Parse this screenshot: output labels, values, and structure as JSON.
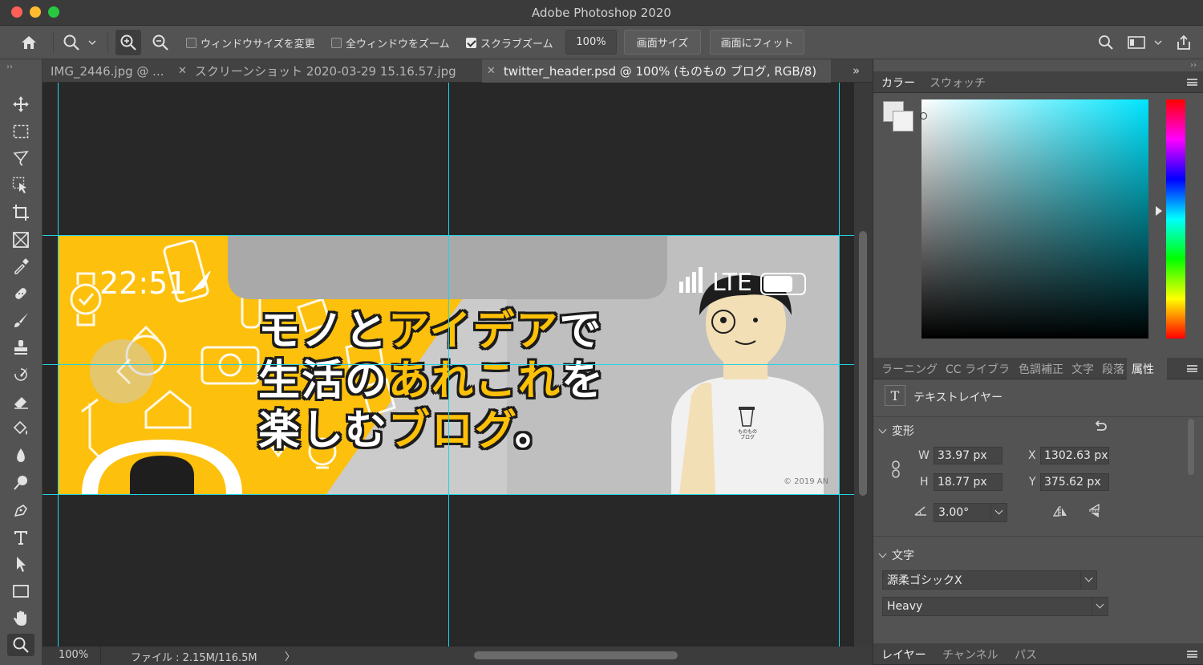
{
  "window": {
    "title": "Adobe Photoshop 2020"
  },
  "options_bar": {
    "resize_windows_label": "ウィンドウサイズを変更",
    "zoom_all_label": "全ウィンドウをズーム",
    "scrubby_zoom_label": "スクラブズーム",
    "scrubby_zoom_checked": true,
    "zoom_value": "100%",
    "actual_size_label": "画面サイズ",
    "fit_screen_label": "画面にフィット"
  },
  "doc_tabs": [
    {
      "label": "IMG_2446.jpg @ ...",
      "active": false
    },
    {
      "label": "スクリーンショット 2020-03-29 15.16.57.jpg",
      "active": false
    },
    {
      "label": "twitter_header.psd @ 100% (ものもの ブログ, RGB/8)",
      "active": true
    }
  ],
  "artwork": {
    "time": "22:51",
    "network": "LTE",
    "line1a": "モノと",
    "line1b": "アイデア",
    "line1c": "で",
    "line2a": "生活の",
    "line2b": "あれこれ",
    "line2c": "を",
    "line3a": "楽しむ",
    "line3b": "ブログ",
    "line3c": "。",
    "copyright": "© 2019 AN",
    "shirt_logo": "ものもの\nブログ"
  },
  "status_bar": {
    "zoom": "100%",
    "file_info": "ファイル : 2.15M/116.5M"
  },
  "color_panel": {
    "tabs": [
      "カラー",
      "スウォッチ"
    ],
    "active": 0
  },
  "props_panel": {
    "tabs": [
      "ラーニング",
      "CC ライブラ",
      "色調補正",
      "文字",
      "段落",
      "属性"
    ],
    "active": 5,
    "layer_type": "テキストレイヤー",
    "transform_title": "変形",
    "w_label": "W",
    "w_value": "33.97 px",
    "h_label": "H",
    "h_value": "18.77 px",
    "x_label": "X",
    "x_value": "1302.63 px",
    "y_label": "Y",
    "y_value": "375.62 px",
    "angle_value": "3.00°",
    "character_title": "文字",
    "font_family": "源柔ゴシックX",
    "font_style": "Heavy"
  },
  "layers_panel": {
    "tabs": [
      "レイヤー",
      "チャンネル",
      "パス"
    ],
    "active": 0
  },
  "colors": {
    "guide": "#22d3e6",
    "accent_yellow": "#ffc107",
    "app_bg": "#535353"
  }
}
